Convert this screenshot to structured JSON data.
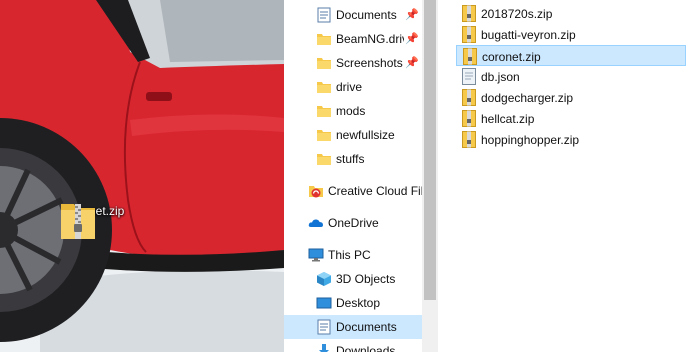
{
  "desktop": {
    "icon_label": "coronet.zip",
    "icon_name": "zip-folder-icon"
  },
  "nav": {
    "items": [
      {
        "label": "Documents",
        "icon": "documents-icon",
        "pinned": true
      },
      {
        "label": "BeamNG.driv",
        "icon": "folder-icon",
        "pinned": true
      },
      {
        "label": "Screenshots",
        "icon": "folder-icon",
        "pinned": true
      },
      {
        "label": "drive",
        "icon": "folder-icon",
        "pinned": false
      },
      {
        "label": "mods",
        "icon": "folder-icon",
        "pinned": false
      },
      {
        "label": "newfullsize",
        "icon": "folder-icon",
        "pinned": false
      },
      {
        "label": "stuffs",
        "icon": "folder-icon",
        "pinned": false
      },
      {
        "label": "Creative Cloud Fil",
        "icon": "creative-cloud-icon",
        "pinned": false
      },
      {
        "label": "OneDrive",
        "icon": "onedrive-icon",
        "pinned": false
      },
      {
        "label": "This PC",
        "icon": "this-pc-icon",
        "pinned": false
      },
      {
        "label": "3D Objects",
        "icon": "3d-objects-icon",
        "pinned": false
      },
      {
        "label": "Desktop",
        "icon": "desktop-icon",
        "pinned": false
      },
      {
        "label": "Documents",
        "icon": "documents-icon",
        "pinned": false,
        "selected": true
      },
      {
        "label": "Downloads",
        "icon": "downloads-icon",
        "pinned": false
      }
    ],
    "pin_glyph": "📌"
  },
  "files": [
    {
      "name": "2018720s.zip",
      "icon": "zip-file-icon"
    },
    {
      "name": "bugatti-veyron.zip",
      "icon": "zip-file-icon"
    },
    {
      "name": "coronet.zip",
      "icon": "zip-file-icon",
      "selected": true
    },
    {
      "name": "db.json",
      "icon": "json-file-icon"
    },
    {
      "name": "dodgecharger.zip",
      "icon": "zip-file-icon"
    },
    {
      "name": "hellcat.zip",
      "icon": "zip-file-icon"
    },
    {
      "name": "hoppinghopper.zip",
      "icon": "zip-file-icon"
    }
  ],
  "colors": {
    "selection": "#cce8ff",
    "selection_border": "#99d1ff",
    "folder": "#f6c94a",
    "car_red": "#d8262f"
  }
}
